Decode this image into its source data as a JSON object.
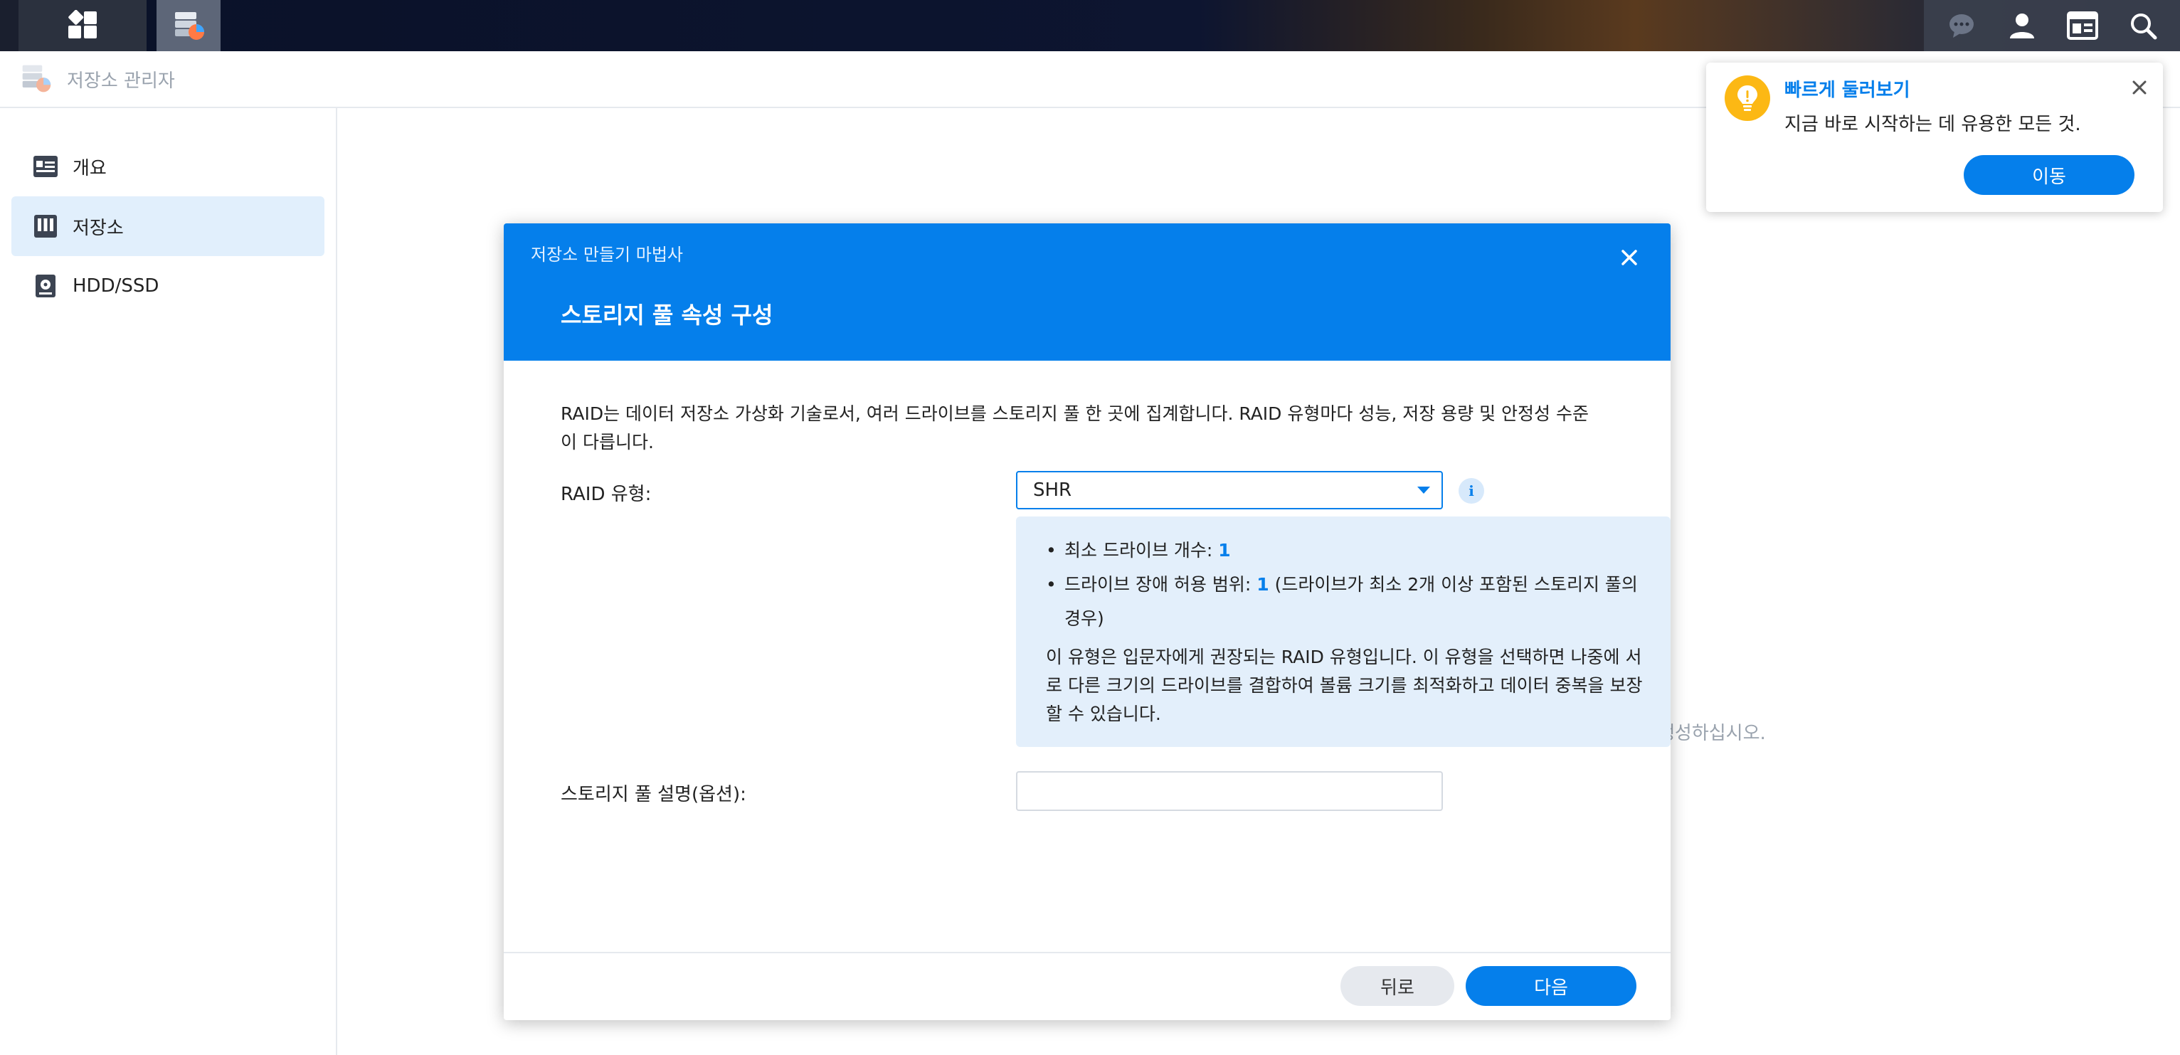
{
  "taskbar": {
    "main_menu_icon": "grid-icon",
    "app_icon": "storage-manager-icon",
    "right_icons": [
      "chat-icon",
      "user-icon",
      "widgets-icon",
      "search-icon"
    ]
  },
  "app": {
    "title": "저장소 관리자"
  },
  "sidebar": {
    "items": [
      {
        "label": "개요",
        "icon": "overview-icon",
        "active": false
      },
      {
        "label": "저장소",
        "icon": "storage-icon",
        "active": true
      },
      {
        "label": "HDD/SSD",
        "icon": "drive-icon",
        "active": false
      }
    ]
  },
  "background": {
    "hint_fragment": "생성하십시오."
  },
  "dialog": {
    "wizard_title": "저장소 만들기 마법사",
    "heading": "스토리지 풀 속성 구성",
    "intro": "RAID는 데이터 저장소 가상화 기술로서, 여러 드라이브를 스토리지 풀 한 곳에 집계합니다. RAID 유형마다 성능, 저장 용량 및 안정성 수준이 다릅니다.",
    "raid_label": "RAID 유형:",
    "raid_value": "SHR",
    "info": {
      "min_drives_label": "최소 드라이브 개수: ",
      "min_drives_value": "1",
      "fault_label": "드라이브 장애 허용 범위: ",
      "fault_value": "1",
      "fault_note": " (드라이브가 최소 2개 이상 포함된 스토리지 풀의 경우)",
      "description": "이 유형은 입문자에게 권장되는 RAID 유형입니다. 이 유형을 선택하면 나중에 서로 다른 크기의 드라이브를 결합하여 볼륨 크기를 최적화하고 데이터 중복을 보장할 수 있습니다."
    },
    "desc_label": "스토리지 풀 설명(옵션):",
    "desc_value": "",
    "back_label": "뒤로",
    "next_label": "다음"
  },
  "quick_tour": {
    "title": "빠르게 둘러보기",
    "message": "지금 바로 시작하는 데 유용한 모든 것.",
    "button": "이동"
  },
  "colors": {
    "accent": "#057feb",
    "info_bg": "#e3effb",
    "bulb": "#fcb814"
  }
}
